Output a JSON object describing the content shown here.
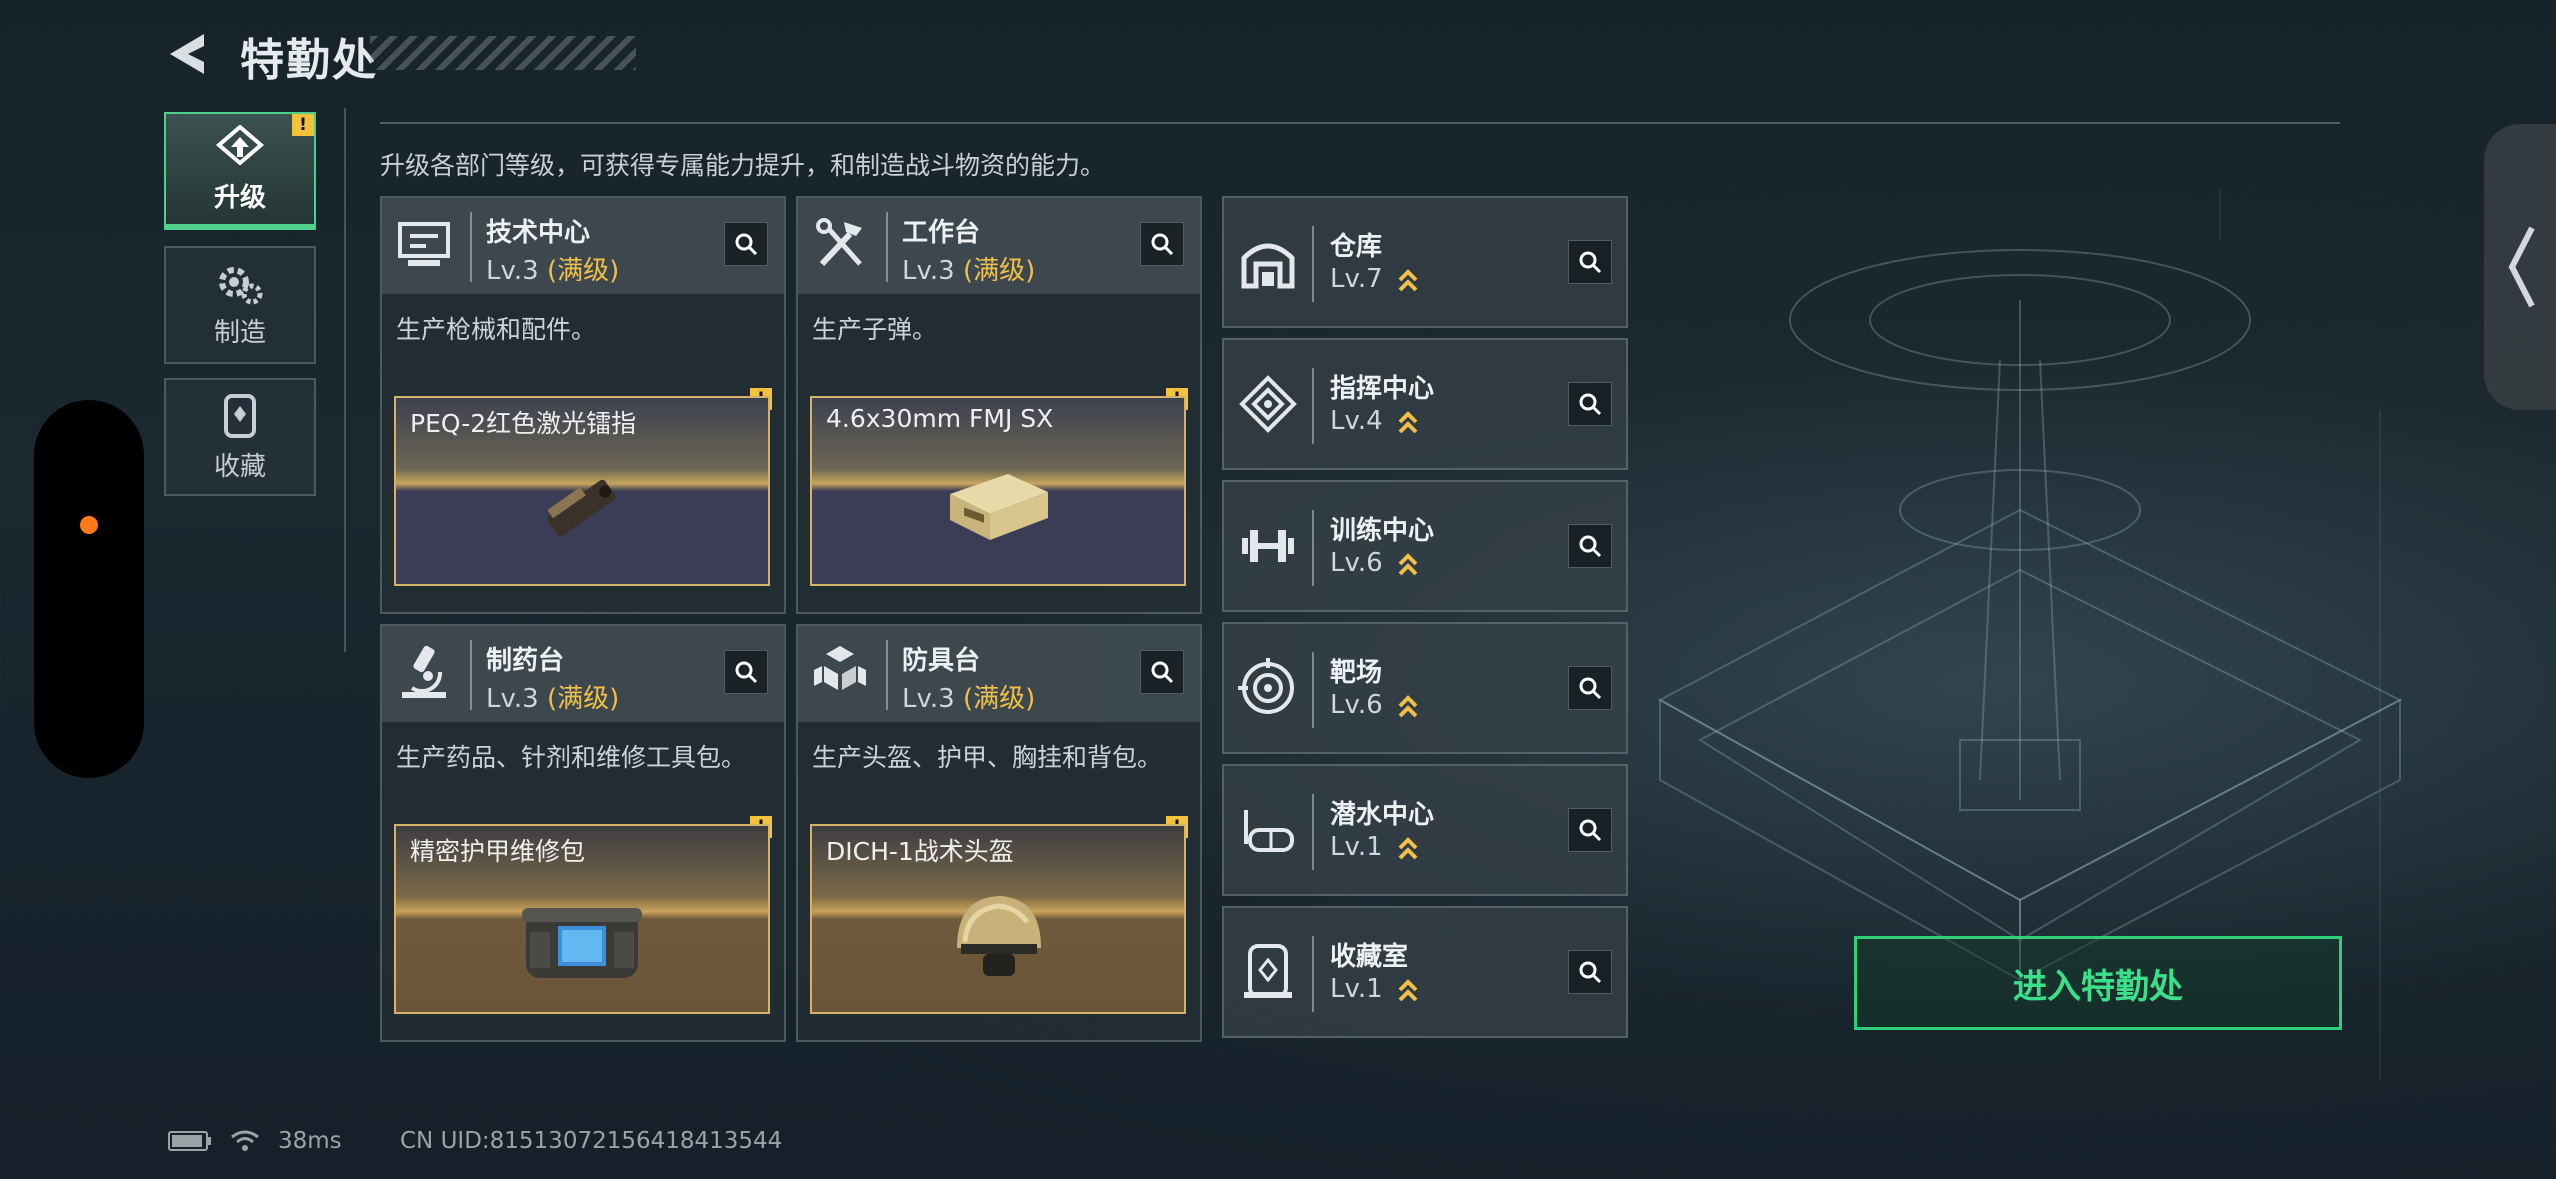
{
  "header": {
    "title": "特勤处"
  },
  "description": "升级各部门等级，可获得专属能力提升，和制造战斗物资的能力。",
  "side_tabs": [
    {
      "label": "升级",
      "icon": "upgrade-icon",
      "active": true,
      "warning": "!"
    },
    {
      "label": "制造",
      "icon": "gears-icon",
      "active": false
    },
    {
      "label": "收藏",
      "icon": "collection-icon",
      "active": false
    }
  ],
  "cards": [
    {
      "name": "技术中心",
      "level": "Lv.3",
      "max_tag": "(满级)",
      "desc": "生产枪械和配件。",
      "item": "PEQ-2红色激光镭指",
      "icon": "computer-icon",
      "warning": "!"
    },
    {
      "name": "工作台",
      "level": "Lv.3",
      "max_tag": "(满级)",
      "desc": "生产子弹。",
      "item": "4.6x30mm FMJ SX",
      "icon": "tools-icon",
      "warning": "!"
    },
    {
      "name": "制药台",
      "level": "Lv.3",
      "max_tag": "(满级)",
      "desc": "生产药品、针剂和维修工具包。",
      "item": "精密护甲维修包",
      "icon": "microscope-icon",
      "warning": "!"
    },
    {
      "name": "防具台",
      "level": "Lv.3",
      "max_tag": "(满级)",
      "desc": "生产头盔、护甲、胸挂和背包。",
      "item": "DICH-1战术头盔",
      "icon": "armor-icon",
      "warning": "!"
    }
  ],
  "facilities": [
    {
      "name": "仓库",
      "level": "Lv.7",
      "icon": "warehouse-icon"
    },
    {
      "name": "指挥中心",
      "level": "Lv.4",
      "icon": "command-icon"
    },
    {
      "name": "训练中心",
      "level": "Lv.6",
      "icon": "dumbbell-icon"
    },
    {
      "name": "靶场",
      "level": "Lv.6",
      "icon": "target-icon"
    },
    {
      "name": "潜水中心",
      "level": "Lv.1",
      "icon": "diving-mask-icon"
    },
    {
      "name": "收藏室",
      "level": "Lv.1",
      "icon": "collection-room-icon"
    }
  ],
  "enter_button": "进入特勤处",
  "status": {
    "ping": "38ms",
    "uid": "CN UID:81513072156418413544"
  },
  "colors": {
    "accent_green": "#3de08a",
    "max_level": "#f0c04a",
    "warning": "#f3c13a"
  }
}
